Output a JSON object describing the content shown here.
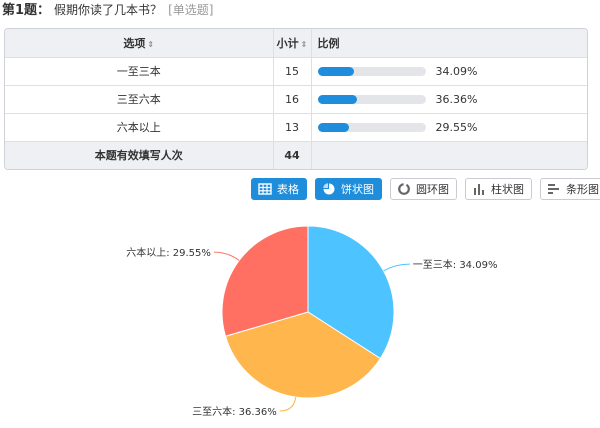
{
  "question": {
    "number": "第1题：",
    "title": "假期你读了几本书？",
    "type": "[单选题]"
  },
  "table": {
    "headers": {
      "option": "选项",
      "count": "小计",
      "ratio": "比例"
    },
    "sort_glyph": "⇕",
    "rows": [
      {
        "option": "一至三本",
        "count": "15",
        "percent": "34.09%",
        "fraction": 0.3409
      },
      {
        "option": "三至六本",
        "count": "16",
        "percent": "36.36%",
        "fraction": 0.3636
      },
      {
        "option": "六本以上",
        "count": "13",
        "percent": "29.55%",
        "fraction": 0.2955
      }
    ],
    "total": {
      "label": "本题有效填写人次",
      "count": "44"
    }
  },
  "toolbar": {
    "buttons": [
      {
        "label": "表格",
        "icon": "table-icon",
        "active": true
      },
      {
        "label": "饼状图",
        "icon": "pie-chart-icon",
        "active": true
      },
      {
        "label": "圆环图",
        "icon": "donut-chart-icon",
        "active": false
      },
      {
        "label": "柱状图",
        "icon": "bar-chart-icon",
        "active": false
      },
      {
        "label": "条形图",
        "icon": "horizontal-bar-chart-icon",
        "active": false
      }
    ]
  },
  "colors": {
    "accent": "#1e8ddb",
    "slice_1": "#4dc3ff",
    "slice_2": "#ffb64c",
    "slice_3": "#ff7063"
  },
  "chart_data": {
    "type": "pie",
    "categories": [
      "一至三本",
      "三至六本",
      "六本以上"
    ],
    "values": [
      34.09,
      36.36,
      29.55
    ],
    "labels": [
      "一至三本: 34.09%",
      "三至六本: 36.36%",
      "六本以上: 29.55%"
    ],
    "colors": [
      "#4dc3ff",
      "#ffb64c",
      "#ff7063"
    ],
    "start": "12 o'clock",
    "direction": "clockwise"
  }
}
